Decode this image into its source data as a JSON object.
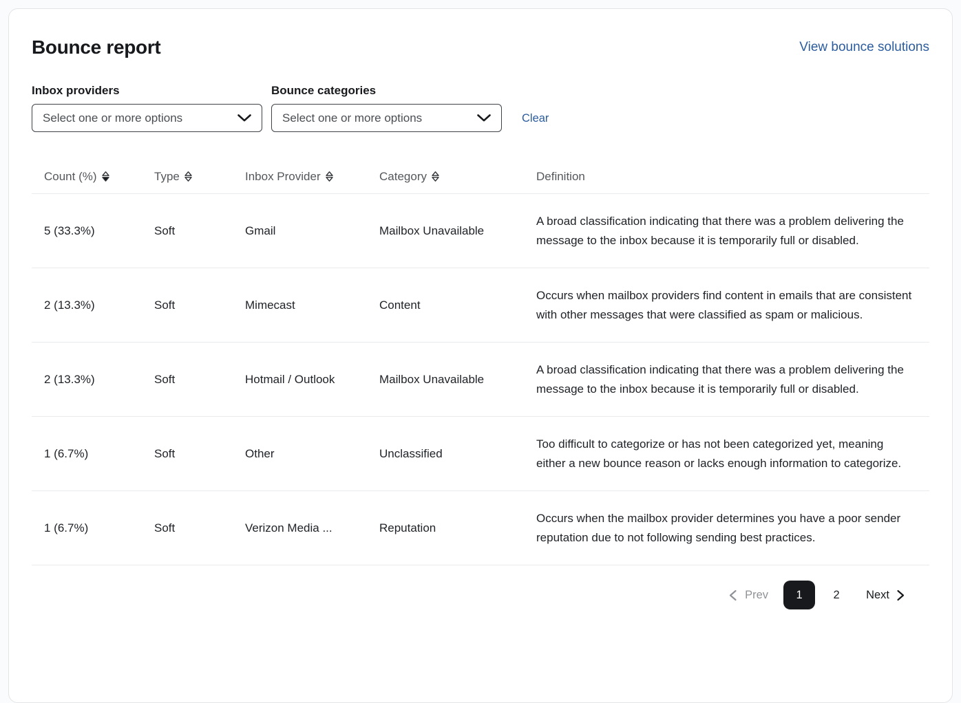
{
  "page": {
    "title": "Bounce report",
    "view_solutions_link": "View bounce solutions"
  },
  "filters": {
    "inbox_providers": {
      "label": "Inbox providers",
      "placeholder": "Select one or more options"
    },
    "bounce_categories": {
      "label": "Bounce categories",
      "placeholder": "Select one or more options"
    },
    "clear_label": "Clear"
  },
  "table": {
    "columns": [
      {
        "label": "Count (%)",
        "key": "count",
        "sortable": true,
        "sort": "desc"
      },
      {
        "label": "Type",
        "key": "type",
        "sortable": true,
        "sort": "none"
      },
      {
        "label": "Inbox Provider",
        "key": "inbox-provider",
        "sortable": true,
        "sort": "none"
      },
      {
        "label": "Category",
        "key": "category",
        "sortable": true,
        "sort": "none"
      },
      {
        "label": "Definition",
        "key": "definition",
        "sortable": false,
        "sort": "none"
      }
    ],
    "rows": [
      [
        "5 (33.3%)",
        "Soft",
        "Gmail",
        "Mailbox Unavailable",
        "A broad classification indicating that there was a problem delivering the message to the inbox because it is temporarily full or disabled."
      ],
      [
        "2 (13.3%)",
        "Soft",
        "Mimecast",
        "Content",
        "Occurs when mailbox providers find content in emails that are consistent with other messages that were classified as spam or malicious."
      ],
      [
        "2 (13.3%)",
        "Soft",
        "Hotmail / Outlook",
        "Mailbox Unavailable",
        "A broad classification indicating that there was a problem delivering the message to the inbox because it is temporarily full or disabled."
      ],
      [
        "1 (6.7%)",
        "Soft",
        "Other",
        "Unclassified",
        "Too difficult to categorize or has not been categorized yet, meaning either a new bounce reason or lacks enough information to categorize."
      ],
      [
        "1 (6.7%)",
        "Soft",
        "Verizon Media ...",
        "Reputation",
        "Occurs when the mailbox provider determines you have a poor sender reputation due to not following sending best practices."
      ]
    ]
  },
  "pagination": {
    "prev_label": "Prev",
    "pages": [
      "1",
      "2"
    ],
    "active_page": "1",
    "next_label": "Next"
  },
  "colors": {
    "link_blue": "#2b5c9e",
    "text_dark": "#17191c",
    "header_gray": "#54575b",
    "active_page_bg": "#17191c",
    "divider": "#eaebec"
  }
}
